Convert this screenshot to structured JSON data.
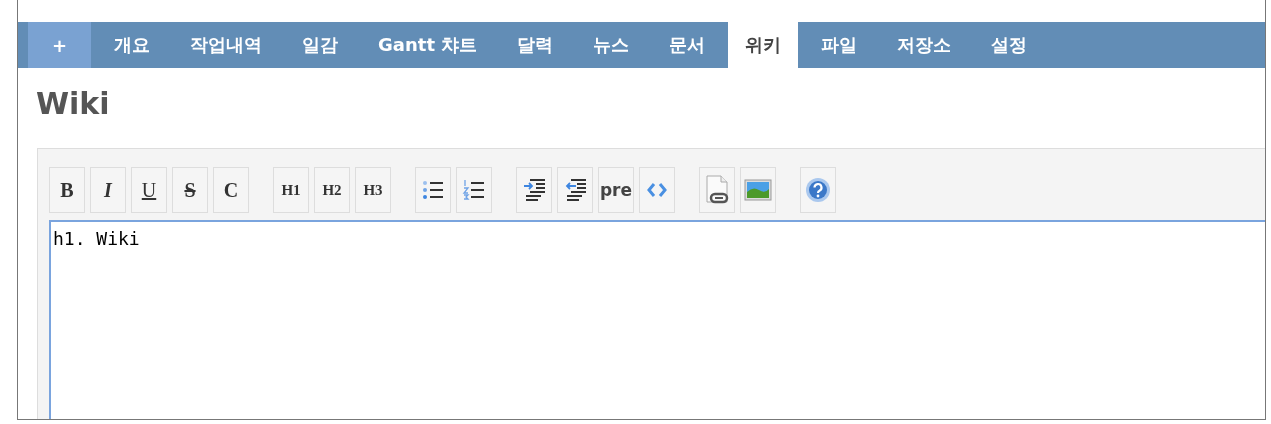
{
  "tabs": [
    {
      "label": "+",
      "kind": "new",
      "selected": false
    },
    {
      "label": "개요",
      "kind": "tab",
      "selected": false
    },
    {
      "label": "작업내역",
      "kind": "tab",
      "selected": false
    },
    {
      "label": "일감",
      "kind": "tab",
      "selected": false
    },
    {
      "label": "Gantt 챠트",
      "kind": "tab",
      "selected": false
    },
    {
      "label": "달력",
      "kind": "tab",
      "selected": false
    },
    {
      "label": "뉴스",
      "kind": "tab",
      "selected": false
    },
    {
      "label": "문서",
      "kind": "tab",
      "selected": false
    },
    {
      "label": "위키",
      "kind": "tab",
      "selected": true
    },
    {
      "label": "파일",
      "kind": "tab",
      "selected": false
    },
    {
      "label": "저장소",
      "kind": "tab",
      "selected": false
    },
    {
      "label": "설정",
      "kind": "tab",
      "selected": false
    }
  ],
  "heading": "Wiki",
  "toolbar": [
    [
      {
        "kind": "bold",
        "label": "B"
      },
      {
        "kind": "italic",
        "label": "I"
      },
      {
        "kind": "underline",
        "label": "U"
      },
      {
        "kind": "strike",
        "label": "S"
      },
      {
        "kind": "inline-code",
        "label": "C"
      }
    ],
    [
      {
        "kind": "heading",
        "label": "H1"
      },
      {
        "kind": "heading",
        "label": "H2"
      },
      {
        "kind": "heading",
        "label": "H3"
      }
    ],
    [
      {
        "kind": "ul"
      },
      {
        "kind": "ol"
      }
    ],
    [
      {
        "kind": "indent"
      },
      {
        "kind": "outdent"
      },
      {
        "kind": "pre",
        "label": "pre"
      },
      {
        "kind": "code"
      }
    ],
    [
      {
        "kind": "link"
      },
      {
        "kind": "image"
      }
    ],
    [
      {
        "kind": "help"
      }
    ]
  ],
  "editor": {
    "value": "h1. Wiki"
  }
}
